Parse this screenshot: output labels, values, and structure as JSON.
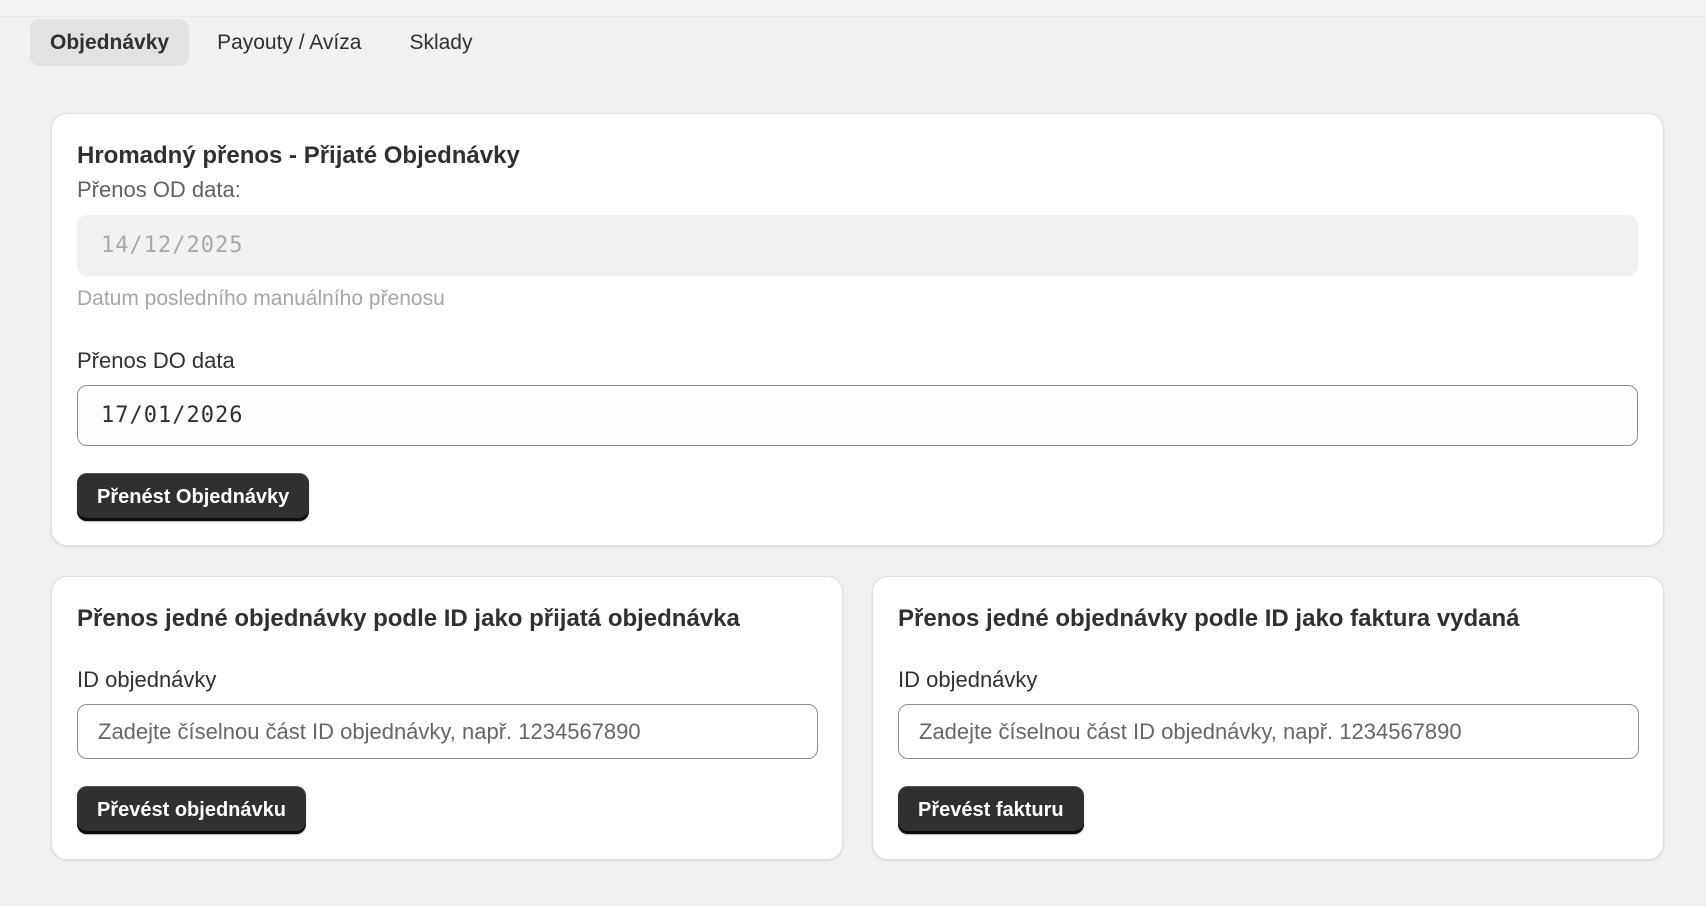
{
  "tabs": [
    {
      "label": "Objednávky",
      "active": true
    },
    {
      "label": "Payouty / Avíza",
      "active": false
    },
    {
      "label": "Sklady",
      "active": false
    }
  ],
  "bulk": {
    "title": "Hromadný přenos - Přijaté Objednávky",
    "from_label": "Přenos OD data:",
    "from_value": "14/12/2025",
    "from_help": "Datum posledního manuálního přenosu",
    "to_label": "Přenos DO data",
    "to_value": "17/01/2026",
    "submit_label": "Přenést Objednávky"
  },
  "single_order": {
    "title": "Přenos jedné objednávky podle ID jako přijatá objednávka",
    "id_label": "ID objednávky",
    "id_placeholder": "Zadejte číselnou část ID objednávky, např. 1234567890",
    "submit_label": "Převést objednávku"
  },
  "single_invoice": {
    "title": "Přenos jedné objednávky podle ID jako faktura vydaná",
    "id_label": "ID objednávky",
    "id_placeholder": "Zadejte číselnou část ID objednávky, např. 1234567890",
    "submit_label": "Převést fakturu"
  },
  "colors": {
    "background": "#f1f1f1",
    "card": "#ffffff",
    "button": "#303030",
    "active_tab": "#e2e2e2"
  }
}
